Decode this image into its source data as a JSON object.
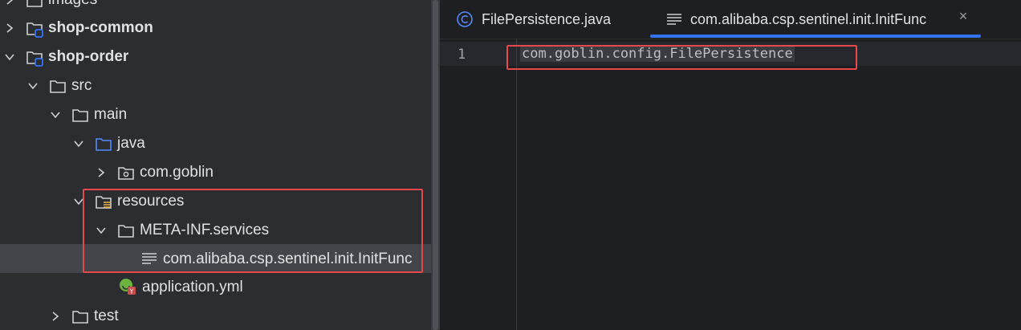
{
  "project_tree": {
    "items": [
      {
        "label": "images",
        "type": "module-folder",
        "expanded": false,
        "bold": false
      },
      {
        "label": "shop-common",
        "type": "module",
        "expanded": false,
        "bold": true
      },
      {
        "label": "shop-order",
        "type": "module",
        "expanded": true,
        "bold": true
      },
      {
        "label": "src",
        "type": "folder",
        "expanded": true
      },
      {
        "label": "main",
        "type": "folder",
        "expanded": true
      },
      {
        "label": "java",
        "type": "source-folder",
        "expanded": true
      },
      {
        "label": "com.goblin",
        "type": "package",
        "expanded": false
      },
      {
        "label": "resources",
        "type": "resources-folder",
        "expanded": true
      },
      {
        "label": "META-INF.services",
        "type": "folder",
        "expanded": true
      },
      {
        "label": "com.alibaba.csp.sentinel.init.InitFunc",
        "type": "text-file",
        "selected": true
      },
      {
        "label": "application.yml",
        "type": "yaml-file"
      },
      {
        "label": "test",
        "type": "folder",
        "expanded": false
      }
    ]
  },
  "editor": {
    "tabs": [
      {
        "label": "FilePersistence.java",
        "icon": "class-icon",
        "active": false
      },
      {
        "label": "com.alibaba.csp.sentinel.init.InitFunc",
        "icon": "text-file-icon",
        "active": true
      }
    ],
    "close_glyph": "×",
    "lines": [
      {
        "number": "1",
        "text": "com.goblin.config.FilePersistence"
      }
    ]
  },
  "colors": {
    "highlight_box": "#e5484d",
    "active_tab_underline": "#3574f0",
    "tree_background": "#2b2d30",
    "editor_background": "#1e1f22"
  }
}
